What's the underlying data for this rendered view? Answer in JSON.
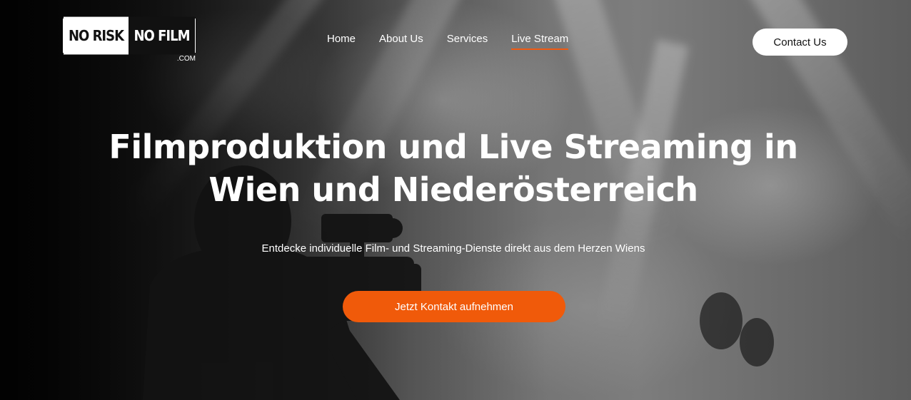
{
  "logo": {
    "left_text": "NO RISK",
    "right_text": "NO FILM",
    "domain": ".COM"
  },
  "nav": {
    "items": [
      {
        "label": "Home",
        "active": false
      },
      {
        "label": "About Us",
        "active": false
      },
      {
        "label": "Services",
        "active": false
      },
      {
        "label": "Live Stream",
        "active": true
      }
    ]
  },
  "header": {
    "contact_label": "Contact Us"
  },
  "hero": {
    "headline_line1": "Filmproduktion und Live Streaming in",
    "headline_line2": "Wien und Niederösterreich",
    "subtitle": "Entdecke individuelle Film- und Streaming-Dienste direkt aus dem Herzen Wiens",
    "cta_label": "Jetzt Kontakt aufnehmen"
  },
  "colors": {
    "accent": "#f05a0a",
    "text": "#ffffff",
    "button_bg": "#ffffff"
  }
}
